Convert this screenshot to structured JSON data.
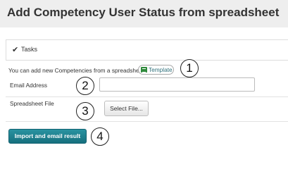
{
  "header": {
    "title": "Add Competency User Status from spreadsheet"
  },
  "tasks": {
    "icon": "checkmark-icon",
    "label": "Tasks"
  },
  "info": {
    "text": "You can add new Competencies from a spreadsheet",
    "template_link": "Template",
    "template_icon": "spreadsheet-icon"
  },
  "form": {
    "email_label": "Email Address",
    "email_value": "",
    "file_label": "Spreadsheet File",
    "select_file_button": "Select File..."
  },
  "actions": {
    "import_button": "Import and email result"
  },
  "callouts": [
    "1",
    "2",
    "3",
    "4"
  ],
  "colors": {
    "header_bg": "#eeeeee",
    "primary_button": "#1e7f8d",
    "link": "#2e6f7a"
  }
}
